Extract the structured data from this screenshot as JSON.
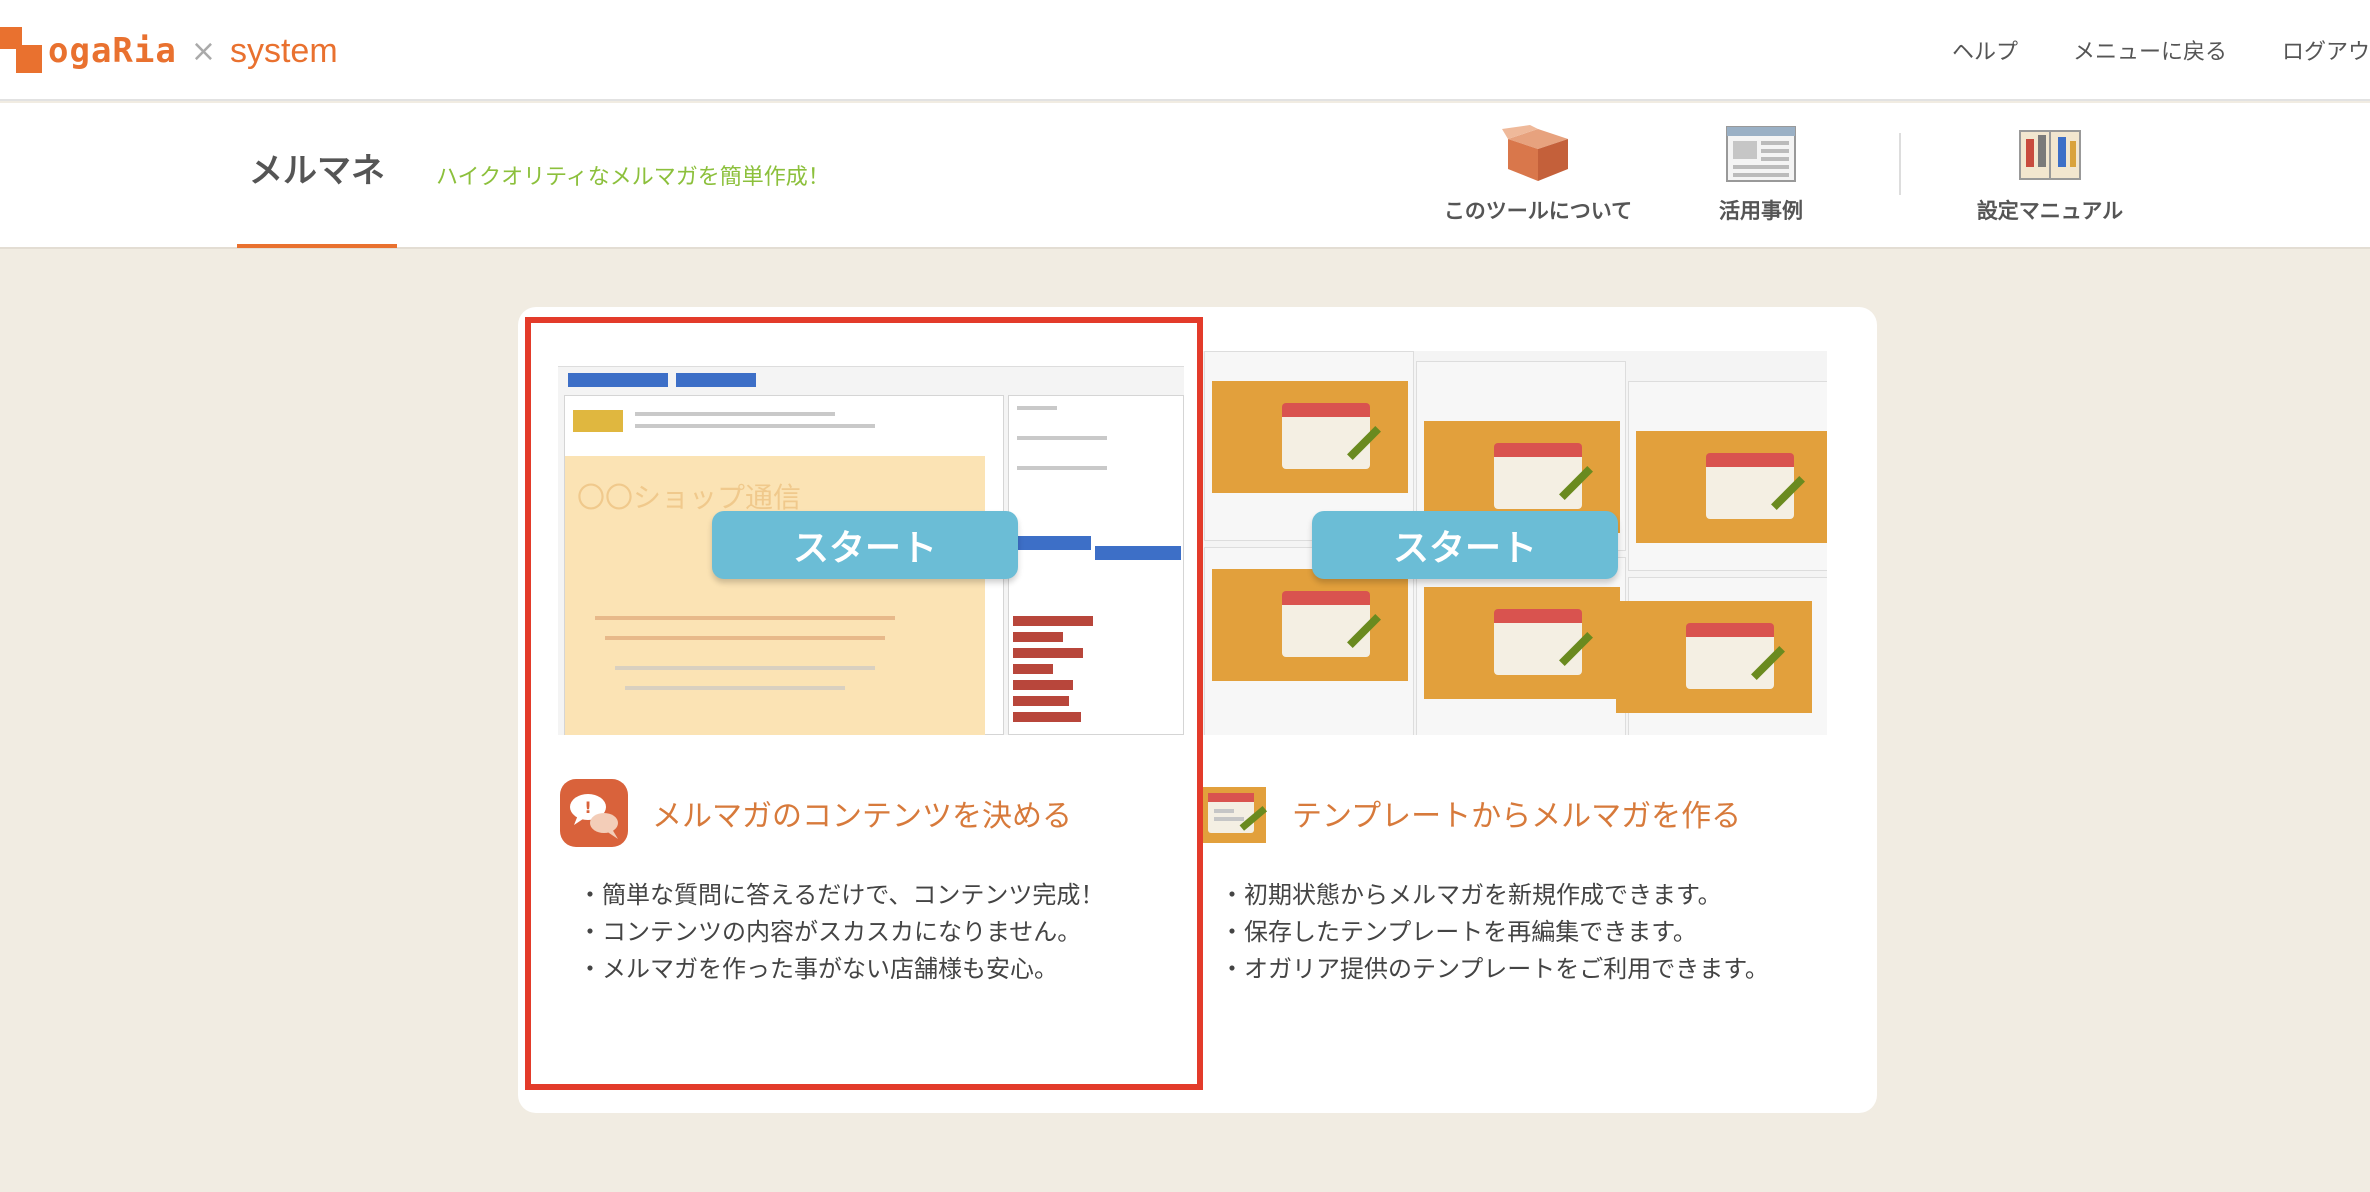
{
  "header": {
    "logo_text": "ogaRia",
    "logo_separator": "×",
    "logo_suffix": "system",
    "nav": [
      {
        "label": "ヘルプ"
      },
      {
        "label": "メニューに戻る"
      },
      {
        "label": "ログアウ"
      }
    ]
  },
  "subheader": {
    "tool_name": "メルマネ",
    "tagline": "ハイクオリティなメルマガを簡単作成！",
    "nav": [
      {
        "label": "このツールについて",
        "icon": "package-box-icon"
      },
      {
        "label": "活用事例",
        "icon": "webpage-icon"
      },
      {
        "label": "設定マニュアル",
        "icon": "manual-book-icon"
      }
    ]
  },
  "options": [
    {
      "start_label": "スタート",
      "title": "メルマガのコンテンツを決める",
      "icon": "speech-bubble-icon",
      "bullets": [
        "・簡単な質問に答えるだけで、コンテンツ完成！",
        "・コンテンツの内容がスカスカになりません。",
        "・メルマガを作った事がない店舗様も安心。"
      ],
      "preview_text": "〇〇ショップ通信"
    },
    {
      "start_label": "スタート",
      "title": "テンプレートからメルマガを作る",
      "icon": "template-edit-icon",
      "bullets": [
        "・初期状態からメルマガを新規作成できます。",
        "・保存したテンプレートを再編集できます。",
        "・オガリア提供のテンプレートをご利用できます。"
      ]
    }
  ],
  "colors": {
    "accent": "#e9712f",
    "tagline": "#8cc03c",
    "start_button": "#6bbdd6",
    "option_title": "#d77a3b",
    "highlight_border": "#e33b2a",
    "page_bg": "#f1ece2"
  }
}
